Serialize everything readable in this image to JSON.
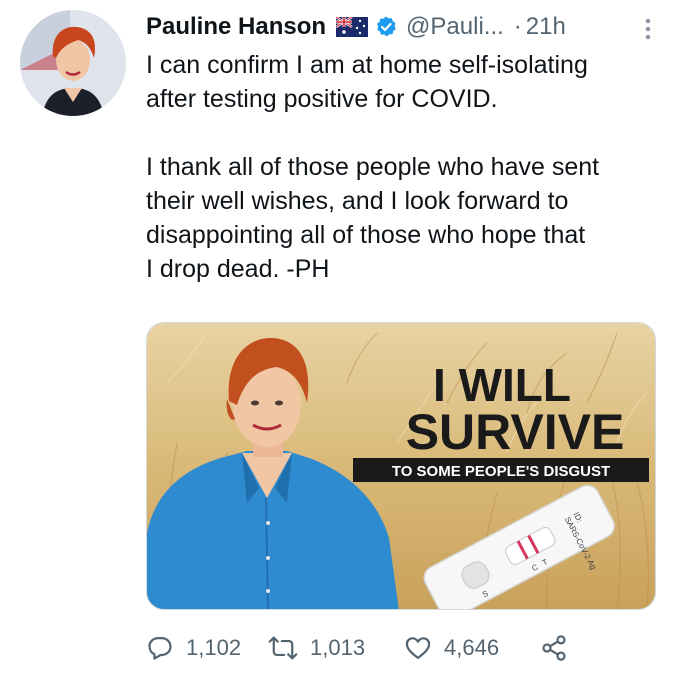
{
  "author": {
    "name": "Pauline Hanson",
    "handle": "@Pauli...",
    "separator": "·",
    "time": "21h",
    "flag_icon": "australian-flag-icon",
    "verified_icon": "verified-badge-icon"
  },
  "tweet": {
    "paragraph1": [
      "I can confirm I am at home self-isolating",
      "after testing positive for COVID."
    ],
    "paragraph2": [
      "I thank all of those people who have sent",
      "their well wishes, and I look forward to",
      "disappointing all of those who hope that",
      "I drop dead. -PH"
    ]
  },
  "media": {
    "headline_line1": "I WILL",
    "headline_line2": "SURVIVE",
    "banner": "TO SOME PEOPLE'S DISGUST",
    "test_label_line1": "SARS-CoV-2 Ag",
    "test_label_line2": "ID:",
    "test_mark_c": "C",
    "test_mark_t": "T",
    "test_mark_s": "S"
  },
  "actions": {
    "replies": "1,102",
    "retweets": "1,013",
    "likes": "4,646"
  },
  "colors": {
    "text": "#0f1419",
    "secondary": "#536471",
    "verified": "#1d9bf0",
    "banner_bg": "#1a1a1a"
  }
}
